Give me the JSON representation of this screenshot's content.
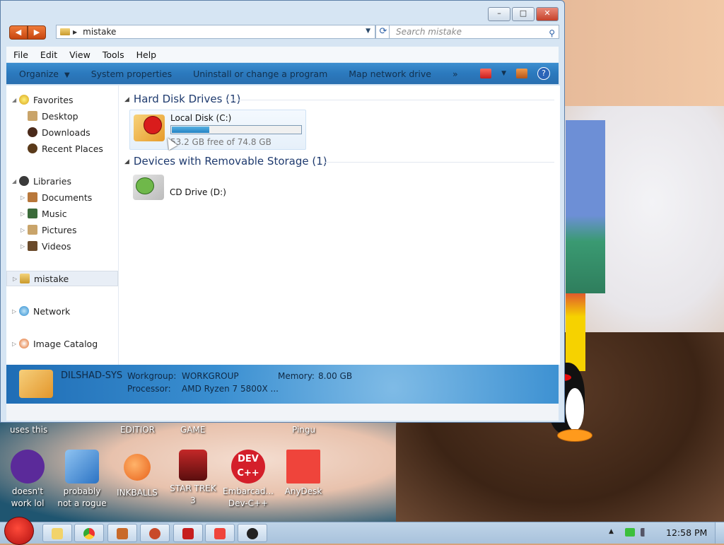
{
  "window": {
    "controls": {
      "minimize": "–",
      "maximize": "□",
      "close": "✕"
    },
    "address": {
      "path": "mistake",
      "search_placeholder": "Search mistake"
    },
    "menu": [
      "File",
      "Edit",
      "View",
      "Tools",
      "Help"
    ],
    "commands": {
      "organize": "Organize",
      "system_properties": "System properties",
      "uninstall": "Uninstall or change a program",
      "map_drive": "Map network drive",
      "more": "»"
    },
    "nav": {
      "favorites": "Favorites",
      "desktop": "Desktop",
      "downloads": "Downloads",
      "recent": "Recent Places",
      "libraries": "Libraries",
      "documents": "Documents",
      "music": "Music",
      "pictures": "Pictures",
      "videos": "Videos",
      "mistake": "mistake",
      "network": "Network",
      "image_catalog": "Image Catalog"
    },
    "content": {
      "hdd_group": "Hard Disk Drives (1)",
      "local_disk": {
        "name": "Local Disk (C:)",
        "free": "53.2 GB free of 74.8 GB",
        "used_fraction": 0.29
      },
      "removable_group": "Devices with Removable Storage (1)",
      "cd_drive": "CD Drive (D:)"
    },
    "details": {
      "computer_name": "DILSHAD-SYS",
      "workgroup_label": "Workgroup:",
      "workgroup_value": "WORKGROUP",
      "memory_label": "Memory:",
      "memory_value": "8.00 GB",
      "processor_label": "Processor:",
      "processor_value": "AMD Ryzen 7 5800X ..."
    }
  },
  "desktop": {
    "labels": [
      "uses this",
      "EDITIOR",
      "GAME",
      "Pingu"
    ],
    "icons": [
      {
        "line1": "doesn't",
        "line2": "work lol",
        "icon": "yahoo-messenger-icon",
        "color": "#5b2a9a"
      },
      {
        "line1": "probably",
        "line2": "not a rogue",
        "icon": "gear-settings-icon",
        "color": "#3f8fd6"
      },
      {
        "line1": "INKBALLS",
        "line2": "",
        "icon": "inkball-icon",
        "color": "#e8621a"
      },
      {
        "line1": "STAR TREK",
        "line2": "3",
        "icon": "star-trek-icon",
        "color": "#9c1c1c"
      },
      {
        "line1": "Embarcad...",
        "line2": "Dev-C++",
        "icon": "dev-cpp-icon",
        "color": "#d41f2a"
      },
      {
        "line1": "AnyDesk",
        "line2": "",
        "icon": "anydesk-icon",
        "color": "#ef443b"
      }
    ]
  },
  "taskbar": {
    "clock": "12:58 PM",
    "pinned": [
      {
        "icon": "explorer-folder-icon",
        "color": "#f2d36a"
      },
      {
        "icon": "chrome-icon",
        "color": "#4a8ff0"
      },
      {
        "icon": "paint-brush-icon",
        "color": "#c86a2a"
      },
      {
        "icon": "angry-birds-icon",
        "color": "#c84a2a"
      },
      {
        "icon": "pdf-reader-icon",
        "color": "#c61e1e"
      },
      {
        "icon": "anydesk-icon",
        "color": "#ef443b"
      },
      {
        "icon": "pingu-icon",
        "color": "#222222"
      }
    ]
  }
}
